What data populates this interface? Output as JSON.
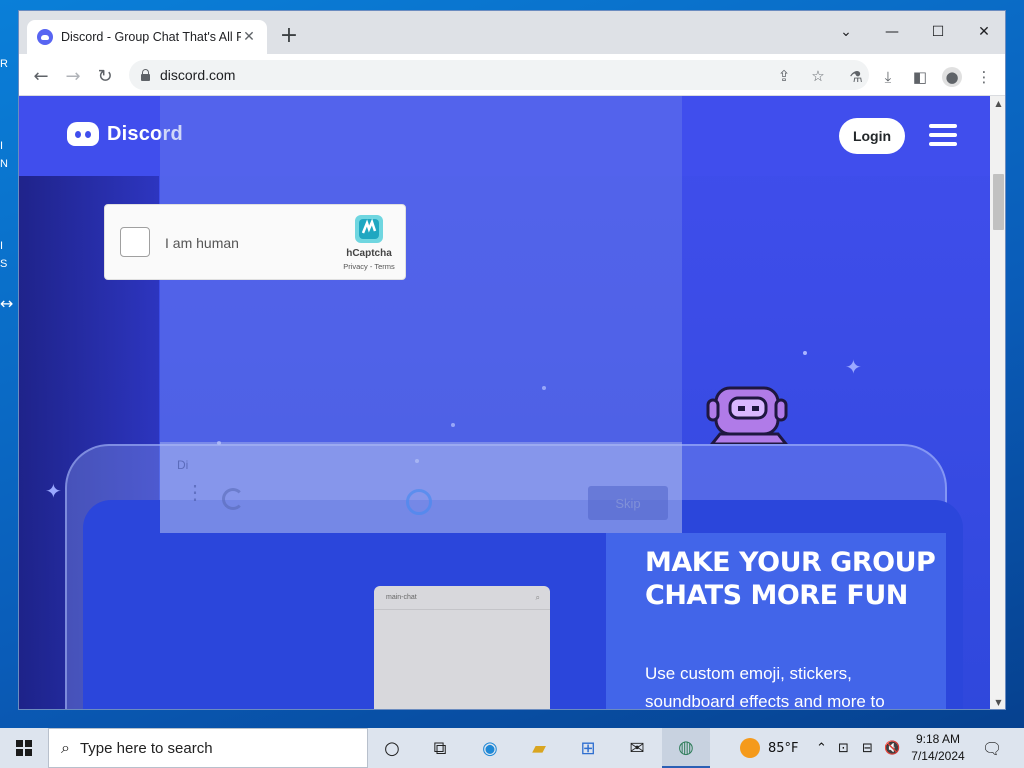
{
  "desktop": {
    "icon_labels": [
      "R",
      "I",
      "N",
      "I",
      "S"
    ]
  },
  "browser": {
    "tab": {
      "title": "Discord - Group Chat That's All Fun & Games"
    },
    "address_bar": {
      "url": "discord.com"
    }
  },
  "site": {
    "logo_text": "Discord",
    "login_label": "Login",
    "captcha": {
      "label": "I am human",
      "brand": "hCaptcha",
      "links": "Privacy - Terms"
    },
    "overlay": {
      "header_text": "Di",
      "skip_label": "Skip"
    },
    "chat_card_title": "main-chat",
    "hero": {
      "title": "MAKE YOUR GROUP CHATS MORE FUN",
      "subtitle": "Use custom emoji, stickers, soundboard effects and more to"
    }
  },
  "taskbar": {
    "search_placeholder": "Type here to search",
    "weather_temp": "85°F",
    "time": "9:18 AM",
    "date": "7/14/2024",
    "apps": [
      "task-view",
      "edge",
      "file-explorer",
      "microsoft-store",
      "mail",
      "browser-active"
    ]
  },
  "colors": {
    "discord_blurple": "#404eed",
    "taskbar_bg": "#dde4ee",
    "desktop_bg": "#0a7fd8"
  }
}
